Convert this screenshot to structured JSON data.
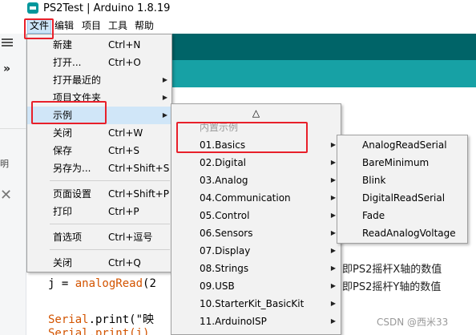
{
  "window": {
    "title": "PS2Test | Arduino 1.8.19"
  },
  "menubar": {
    "items": [
      "文件",
      "编辑",
      "项目",
      "工具",
      "帮助"
    ]
  },
  "file_menu": {
    "groups": [
      [
        {
          "label": "新建",
          "shortcut": "Ctrl+N"
        },
        {
          "label": "打开...",
          "shortcut": "Ctrl+O"
        },
        {
          "label": "打开最近的",
          "shortcut": "",
          "submenu": true
        },
        {
          "label": "项目文件夹",
          "shortcut": "",
          "submenu": true
        },
        {
          "label": "示例",
          "shortcut": "",
          "submenu": true,
          "highlighted": true
        },
        {
          "label": "关闭",
          "shortcut": "Ctrl+W"
        },
        {
          "label": "保存",
          "shortcut": "Ctrl+S"
        },
        {
          "label": "另存为...",
          "shortcut": "Ctrl+Shift+S"
        }
      ],
      [
        {
          "label": "页面设置",
          "shortcut": "Ctrl+Shift+P"
        },
        {
          "label": "打印",
          "shortcut": "Ctrl+P"
        }
      ],
      [
        {
          "label": "首选项",
          "shortcut": "Ctrl+逗号"
        }
      ],
      [
        {
          "label": "关闭",
          "shortcut": "Ctrl+Q"
        }
      ]
    ]
  },
  "examples_menu": {
    "scroll_up": "△",
    "section_header": "内置示例",
    "items": [
      "01.Basics",
      "02.Digital",
      "03.Analog",
      "04.Communication",
      "05.Control",
      "06.Sensors",
      "07.Display",
      "08.Strings",
      "09.USB",
      "10.StarterKit_BasicKit",
      "11.ArduinoISP"
    ]
  },
  "basics_menu": {
    "items": [
      "AnalogReadSerial",
      "BareMinimum",
      "Blink",
      "DigitalReadSerial",
      "Fade",
      "ReadAnalogVoltage"
    ]
  },
  "code": {
    "line1_var": "j = ",
    "line1_fn": "analogRead",
    "line1_rest": "(2",
    "line2_fn": "Serial",
    "line2_rest": ".print(\"映",
    "line3": "Serial.print(i)"
  },
  "comments": [
    "即PS2摇杆X轴的数值",
    "即PS2摇杆Y轴的数值"
  ],
  "sidebar": {
    "collapse_glyph": "»",
    "fragment": "明",
    "close_glyph": "✕"
  },
  "watermark": "CSDN @西米33",
  "colors": {
    "highlight": "#d0e6f8",
    "annotation": "#e8202a",
    "arduino_teal": "#00979c"
  }
}
